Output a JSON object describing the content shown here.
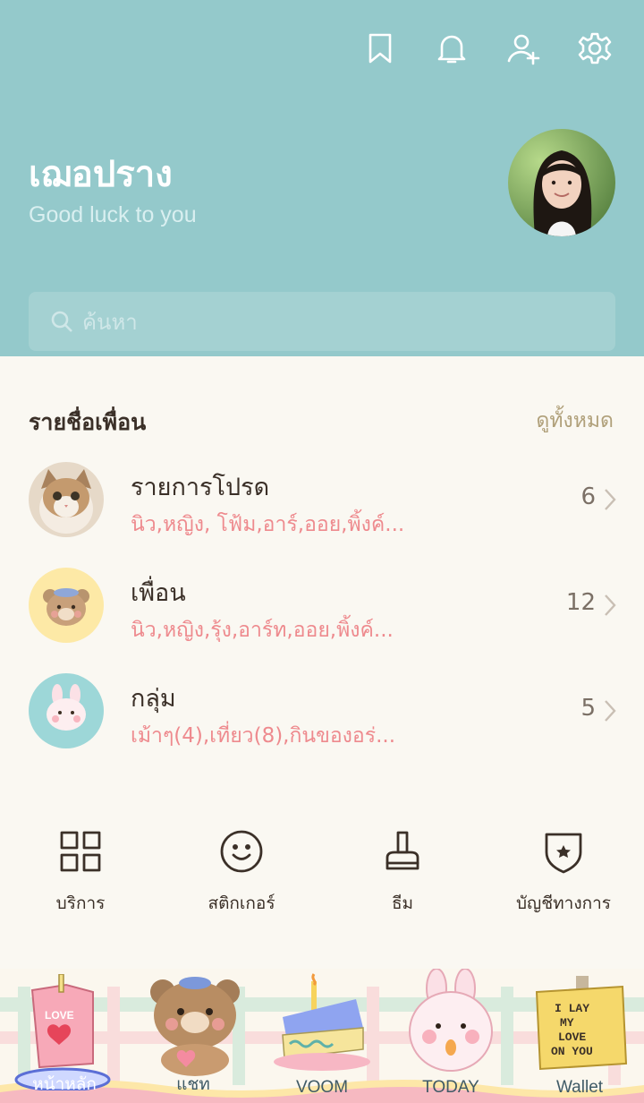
{
  "header": {
    "profile_name": "เฌอปราง",
    "status_message": "Good luck to you",
    "icons": [
      "bookmark-icon",
      "bell-icon",
      "add-friend-icon",
      "gear-icon"
    ],
    "bg_color": "#94c9cb"
  },
  "search": {
    "placeholder": "ค้นหา"
  },
  "friends": {
    "title": "รายชื่อเพื่อน",
    "see_all": "ดูทั้งหมด",
    "rows": [
      {
        "title": "รายการโปรด",
        "subtitle": "นิว,หญิง, โฟ้ม,อาร์,ออย,พิ้งค์...",
        "count": "6"
      },
      {
        "title": "เพื่อน",
        "subtitle": "นิว,หญิง,รุ้ง,อาร์ท,ออย,พิ้งค์...",
        "count": "12"
      },
      {
        "title": "กลุ่ม",
        "subtitle": "เม้าๆ(4),เที่ยว(8),กินของอร่...",
        "count": "5"
      }
    ]
  },
  "actions": [
    {
      "label": "บริการ",
      "icon": "grid-icon"
    },
    {
      "label": "สติกเกอร์",
      "icon": "smiley-icon"
    },
    {
      "label": "ธีม",
      "icon": "brush-icon"
    },
    {
      "label": "บัญชีทางการ",
      "icon": "shield-star-icon"
    }
  ],
  "tabs": [
    {
      "label": "หน้าหลัก",
      "icon": "juice-box-icon"
    },
    {
      "label": "แชท",
      "icon": "bear-icon"
    },
    {
      "label": "VOOM",
      "icon": "cake-icon"
    },
    {
      "label": "TODAY",
      "icon": "bunny-icon"
    },
    {
      "label": "Wallet",
      "icon": "note-icon"
    }
  ],
  "colors": {
    "accent_pink": "#ee8a8e",
    "text_dark": "#3b3028",
    "see_all": "#b0a07a"
  }
}
